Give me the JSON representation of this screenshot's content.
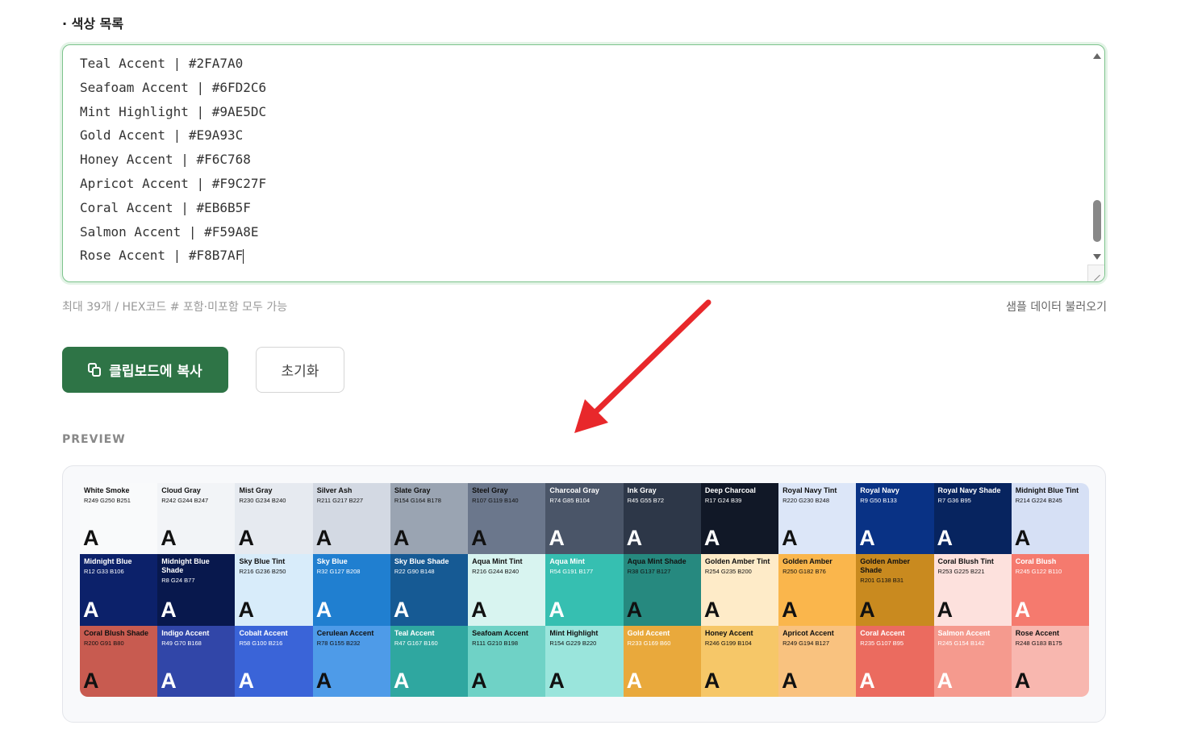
{
  "section_title": "· 색상 목록",
  "textarea_lines": [
    "Teal Accent | #2FA7A0",
    "Seafoam Accent | #6FD2C6",
    "Mint Highlight | #9AE5DC",
    "Gold Accent | #E9A93C",
    "Honey Accent | #F6C768",
    "Apricot Accent | #F9C27F",
    "Coral Accent | #EB6B5F",
    "Salmon Accent | #F59A8E",
    "Rose Accent | #F8B7AF"
  ],
  "hint": "최대 39개 / HEX코드 # 포함·미포함 모두 가능",
  "sample_link": "샘플 데이터 불러오기",
  "copy_button": "클립보드에 복사",
  "reset_button": "초기화",
  "preview_label": "PREVIEW",
  "swatch_letter": "A",
  "colors": {
    "accent_green": "#2e7446",
    "arrow_red": "#e8282b"
  },
  "swatches": [
    {
      "name": "White Smoke",
      "rgb": "R249 G250 B251",
      "hex": "#F9FAFB",
      "text": "#111"
    },
    {
      "name": "Cloud Gray",
      "rgb": "R242 G244 B247",
      "hex": "#F2F4F7",
      "text": "#111"
    },
    {
      "name": "Mist Gray",
      "rgb": "R230 G234 B240",
      "hex": "#E6EAF0",
      "text": "#111"
    },
    {
      "name": "Silver Ash",
      "rgb": "R211 G217 B227",
      "hex": "#D3D9E3",
      "text": "#111"
    },
    {
      "name": "Slate Gray",
      "rgb": "R154 G164 B178",
      "hex": "#9AA4B2",
      "text": "#111"
    },
    {
      "name": "Steel Gray",
      "rgb": "R107 G119 B140",
      "hex": "#6B778C",
      "text": "#111"
    },
    {
      "name": "Charcoal Gray",
      "rgb": "R74 G85 B104",
      "hex": "#4A5568",
      "text": "#fff"
    },
    {
      "name": "Ink Gray",
      "rgb": "R45 G55 B72",
      "hex": "#2D3748",
      "text": "#fff"
    },
    {
      "name": "Deep Charcoal",
      "rgb": "R17 G24 B39",
      "hex": "#111827",
      "text": "#fff"
    },
    {
      "name": "Royal Navy Tint",
      "rgb": "R220 G230 B248",
      "hex": "#DCE6F8",
      "text": "#111"
    },
    {
      "name": "Royal Navy",
      "rgb": "R9 G50 B133",
      "hex": "#093285",
      "text": "#fff"
    },
    {
      "name": "Royal Navy Shade",
      "rgb": "R7 G36 B95",
      "hex": "#07245F",
      "text": "#fff"
    },
    {
      "name": "Midnight Blue Tint",
      "rgb": "R214 G224 B245",
      "hex": "#D6E0F5",
      "text": "#111"
    },
    {
      "name": "Midnight Blue",
      "rgb": "R12 G33 B106",
      "hex": "#0C216A",
      "text": "#fff"
    },
    {
      "name": "Midnight Blue Shade",
      "rgb": "R8 G24 B77",
      "hex": "#08184D",
      "text": "#fff"
    },
    {
      "name": "Sky Blue Tint",
      "rgb": "R216 G236 B250",
      "hex": "#D8ECFA",
      "text": "#111"
    },
    {
      "name": "Sky Blue",
      "rgb": "R32 G127 B208",
      "hex": "#207FD0",
      "text": "#fff"
    },
    {
      "name": "Sky Blue Shade",
      "rgb": "R22 G90 B148",
      "hex": "#165A94",
      "text": "#fff"
    },
    {
      "name": "Aqua Mint Tint",
      "rgb": "R216 G244 B240",
      "hex": "#D8F4F0",
      "text": "#111"
    },
    {
      "name": "Aqua Mint",
      "rgb": "R54 G191 B177",
      "hex": "#36BFB1",
      "text": "#fff"
    },
    {
      "name": "Aqua Mint Shade",
      "rgb": "R38 G137 B127",
      "hex": "#26897F",
      "text": "#111"
    },
    {
      "name": "Golden Amber Tint",
      "rgb": "R254 G235 B200",
      "hex": "#FEEBC8",
      "text": "#111"
    },
    {
      "name": "Golden Amber",
      "rgb": "R250 G182 B76",
      "hex": "#FAB64C",
      "text": "#111"
    },
    {
      "name": "Golden Amber Shade",
      "rgb": "R201 G138 B31",
      "hex": "#C98A1F",
      "text": "#111"
    },
    {
      "name": "Coral Blush Tint",
      "rgb": "R253 G225 B221",
      "hex": "#FDE1DD",
      "text": "#111"
    },
    {
      "name": "Coral Blush",
      "rgb": "R245 G122 B110",
      "hex": "#F57A6E",
      "text": "#fff"
    },
    {
      "name": "Coral Blush Shade",
      "rgb": "R200 G91 B80",
      "hex": "#C85B50",
      "text": "#111"
    },
    {
      "name": "Indigo Accent",
      "rgb": "R49 G70 B168",
      "hex": "#3146A8",
      "text": "#fff"
    },
    {
      "name": "Cobalt Accent",
      "rgb": "R58 G100 B216",
      "hex": "#3A64D8",
      "text": "#fff"
    },
    {
      "name": "Cerulean Accent",
      "rgb": "R78 G155 B232",
      "hex": "#4E9BE8",
      "text": "#111"
    },
    {
      "name": "Teal Accent",
      "rgb": "R47 G167 B160",
      "hex": "#2FA7A0",
      "text": "#fff"
    },
    {
      "name": "Seafoam Accent",
      "rgb": "R111 G210 B198",
      "hex": "#6FD2C6",
      "text": "#111"
    },
    {
      "name": "Mint Highlight",
      "rgb": "R154 G229 B220",
      "hex": "#9AE5DC",
      "text": "#111"
    },
    {
      "name": "Gold Accent",
      "rgb": "R233 G169 B60",
      "hex": "#E9A93C",
      "text": "#fff"
    },
    {
      "name": "Honey Accent",
      "rgb": "R246 G199 B104",
      "hex": "#F6C768",
      "text": "#111"
    },
    {
      "name": "Apricot Accent",
      "rgb": "R249 G194 B127",
      "hex": "#F9C27F",
      "text": "#111"
    },
    {
      "name": "Coral Accent",
      "rgb": "R235 G107 B95",
      "hex": "#EB6B5F",
      "text": "#fff"
    },
    {
      "name": "Salmon Accent",
      "rgb": "R245 G154 B142",
      "hex": "#F59A8E",
      "text": "#fff"
    },
    {
      "name": "Rose Accent",
      "rgb": "R248 G183 B175",
      "hex": "#F8B7AF",
      "text": "#111"
    }
  ]
}
